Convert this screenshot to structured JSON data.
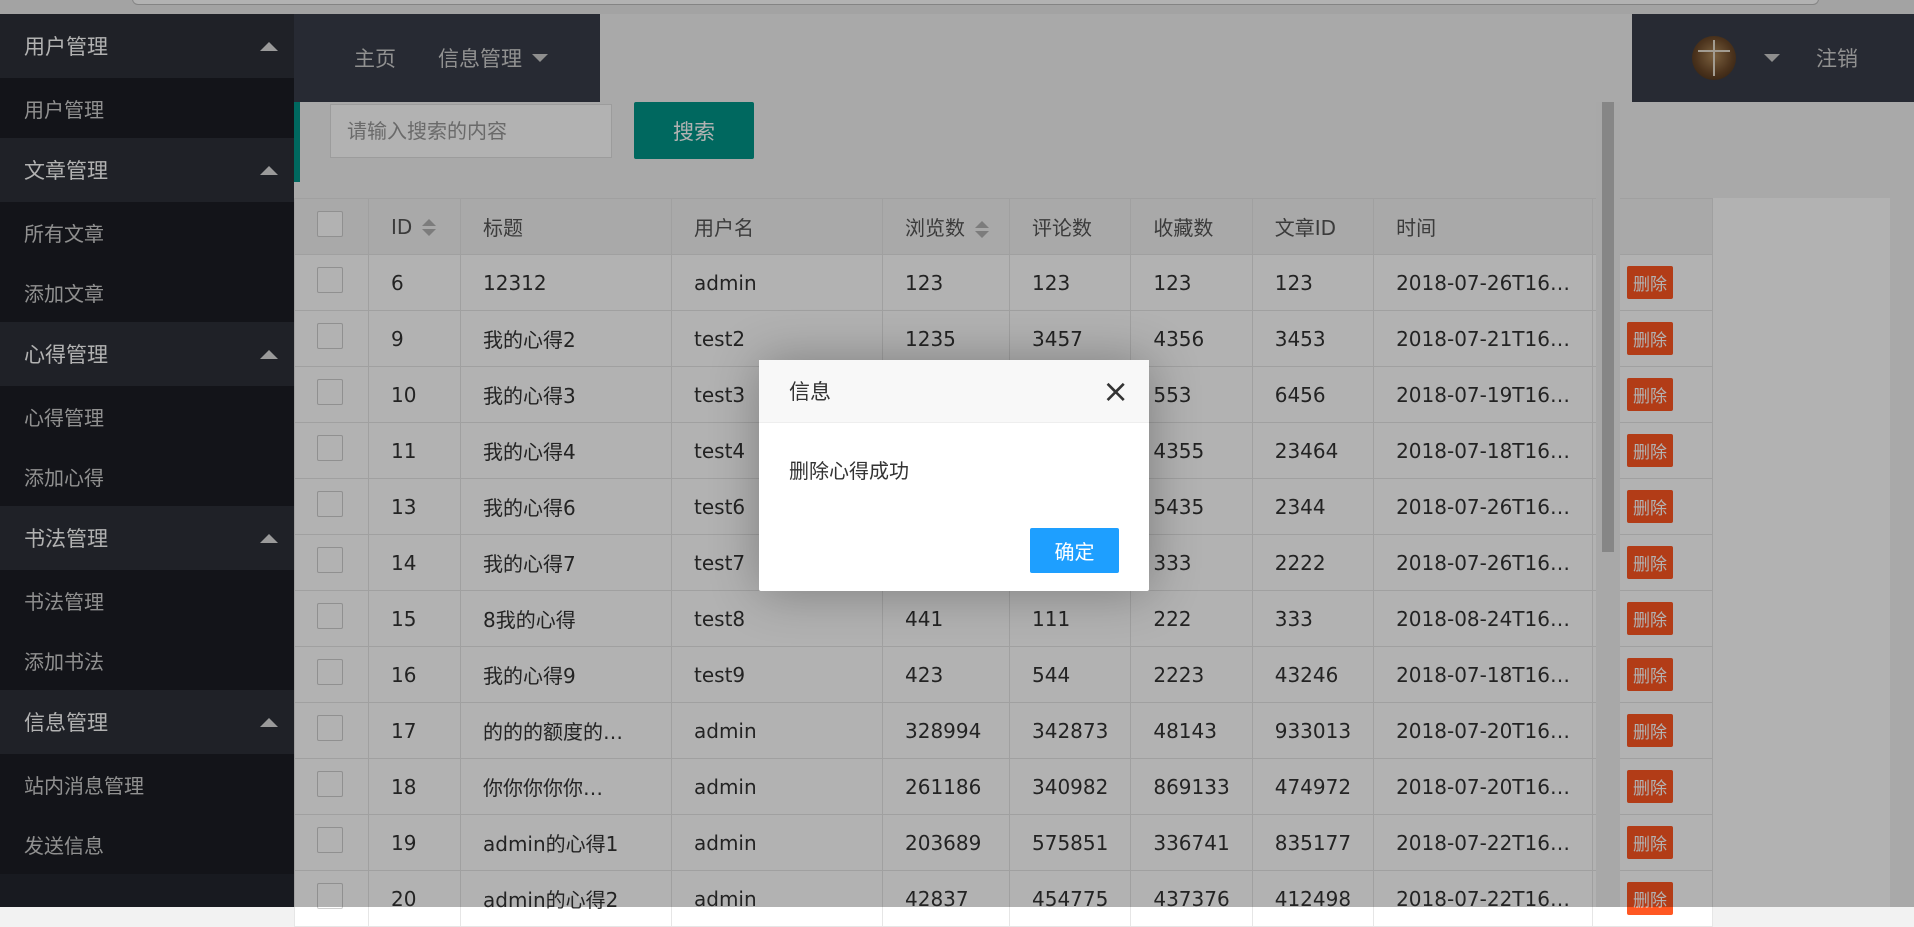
{
  "sidebar": {
    "groups": [
      {
        "label": "用户管理",
        "items": [
          "用户管理"
        ]
      },
      {
        "label": "文章管理",
        "items": [
          "所有文章",
          "添加文章"
        ]
      },
      {
        "label": "心得管理",
        "items": [
          "心得管理",
          "添加心得"
        ]
      },
      {
        "label": "书法管理",
        "items": [
          "书法管理",
          "添加书法"
        ]
      },
      {
        "label": "信息管理",
        "items": [
          "站内消息管理",
          "发送信息"
        ]
      }
    ]
  },
  "topnav": {
    "home": "主页",
    "info_menu": "信息管理"
  },
  "user": {
    "logout": "注销"
  },
  "search": {
    "placeholder": "请输入搜索的内容",
    "button": "搜索"
  },
  "table": {
    "headers": [
      "ID",
      "标题",
      "用户名",
      "浏览数",
      "评论数",
      "收藏数",
      "文章ID",
      "时间"
    ],
    "delete_label": "删除",
    "rows": [
      [
        "6",
        "12312",
        "admin",
        "123",
        "123",
        "123",
        "123",
        "2018-07-26T16…"
      ],
      [
        "9",
        "我的心得2",
        "test2",
        "1235",
        "3457",
        "4356",
        "3453",
        "2018-07-21T16…"
      ],
      [
        "10",
        "我的心得3",
        "test3",
        "",
        "",
        "553",
        "6456",
        "2018-07-19T16…"
      ],
      [
        "11",
        "我的心得4",
        "test4",
        "",
        "",
        "4355",
        "23464",
        "2018-07-18T16…"
      ],
      [
        "13",
        "我的心得6",
        "test6",
        "",
        "",
        "5435",
        "2344",
        "2018-07-26T16…"
      ],
      [
        "14",
        "我的心得7",
        "test7",
        "",
        "",
        "333",
        "2222",
        "2018-07-26T16…"
      ],
      [
        "15",
        "8我的心得",
        "test8",
        "441",
        "111",
        "222",
        "333",
        "2018-08-24T16…"
      ],
      [
        "16",
        "我的心得9",
        "test9",
        "423",
        "544",
        "2223",
        "43246",
        "2018-07-18T16…"
      ],
      [
        "17",
        "的的的额度的…",
        "admin",
        "328994",
        "342873",
        "48143",
        "933013",
        "2018-07-20T16…"
      ],
      [
        "18",
        "你你你你你…",
        "admin",
        "261186",
        "340982",
        "869133",
        "474972",
        "2018-07-20T16…"
      ],
      [
        "19",
        "admin的心得1",
        "admin",
        "203689",
        "575851",
        "336741",
        "835177",
        "2018-07-22T16…"
      ],
      [
        "20",
        "admin的心得2",
        "admin",
        "42837",
        "454775",
        "437376",
        "412498",
        "2018-07-22T16…"
      ]
    ]
  },
  "dialog": {
    "title": "信息",
    "close": "×",
    "message": "删除心得成功",
    "ok": "确定"
  },
  "colors": {
    "accent": "#009688",
    "danger": "#ff5722",
    "primary": "#1e9fff",
    "sidebar": "#23262e"
  }
}
